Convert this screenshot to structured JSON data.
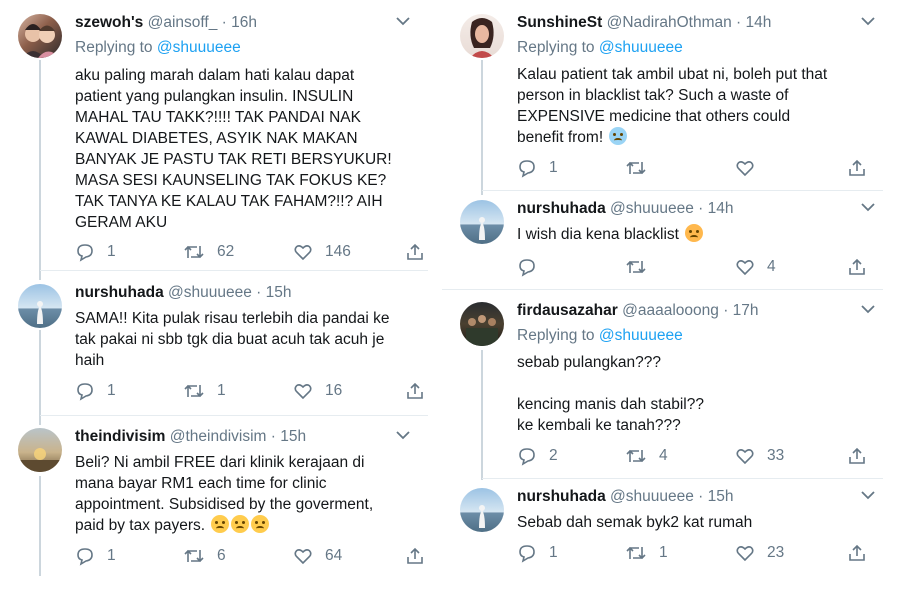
{
  "left": [
    {
      "name": "szewoh's",
      "handle": "@ainsoff_",
      "time": "· 16h",
      "replying_prefix": "Replying to",
      "replying_to": "@shuuueee",
      "lines": [
        "aku paling marah dalam hati kalau dapat",
        "patient yang pulangkan insulin. INSULIN",
        "MAHAL TAU TAKK?!!!! TAK PANDAI NAK",
        "KAWAL DIABETES, ASYIK NAK MAKAN",
        "BANYAK JE PASTU TAK RETI BERSYUKUR!",
        "MASA SESI KAUNSELING TAK FOKUS KE?",
        "TAK TANYA KE KALAU TAK FAHAM?!!? AIH",
        "GERAM AKU"
      ],
      "replies": "1",
      "retweets": "62",
      "likes": "146"
    },
    {
      "name": "nurshuhada",
      "handle": "@shuuueee",
      "time": "· 15h",
      "lines": [
        "SAMA!! Kita pulak risau terlebih dia pandai ke",
        "tak pakai ni sbb tgk dia buat acuh tak acuh je",
        "haih"
      ],
      "replies": "1",
      "retweets": "1",
      "likes": "16"
    },
    {
      "name": "theindivisim",
      "handle": "@theindivisim",
      "time": "· 15h",
      "lines": [
        "Beli? Ni ambil FREE dari klinik kerajaan di",
        "mana bayar RM1 each time for clinic",
        "appointment. Subsidised by the goverment,",
        "paid by tax payers."
      ],
      "replies": "1",
      "retweets": "6",
      "likes": "64"
    }
  ],
  "right": [
    {
      "name": "SunshineSt",
      "handle": "@NadirahOthman",
      "time": "· 14h",
      "replying_prefix": "Replying to",
      "replying_to": "@shuuueee",
      "lines": [
        "Kalau patient tak ambil ubat ni, boleh put that",
        "person in blacklist tak? Such a waste of",
        "EXPENSIVE medicine that others could",
        "benefit from!"
      ],
      "replies": "1",
      "retweets": "",
      "likes": ""
    },
    {
      "name": "nurshuhada",
      "handle": "@shuuueee",
      "time": "· 14h",
      "lines": [
        "I wish dia kena blacklist"
      ],
      "replies": "",
      "retweets": "",
      "likes": "4"
    },
    {
      "name": "firdausazahar",
      "handle": "@aaaalooong",
      "time": "· 17h",
      "replying_prefix": "Replying to",
      "replying_to": "@shuuueee",
      "lines": [
        "sebab pulangkan???",
        "",
        "kencing manis dah stabil??",
        "ke kembali ke tanah???"
      ],
      "replies": "2",
      "retweets": "4",
      "likes": "33"
    },
    {
      "name": "nurshuhada",
      "handle": "@shuuueee",
      "time": "· 15h",
      "lines": [
        "Sebab dah semak byk2 kat rumah"
      ],
      "replies": "1",
      "retweets": "1",
      "likes": "23"
    }
  ],
  "colors": {
    "name": "#14171a",
    "muted": "#657786",
    "link": "#1da1f2",
    "line": "#ccd6dd"
  }
}
